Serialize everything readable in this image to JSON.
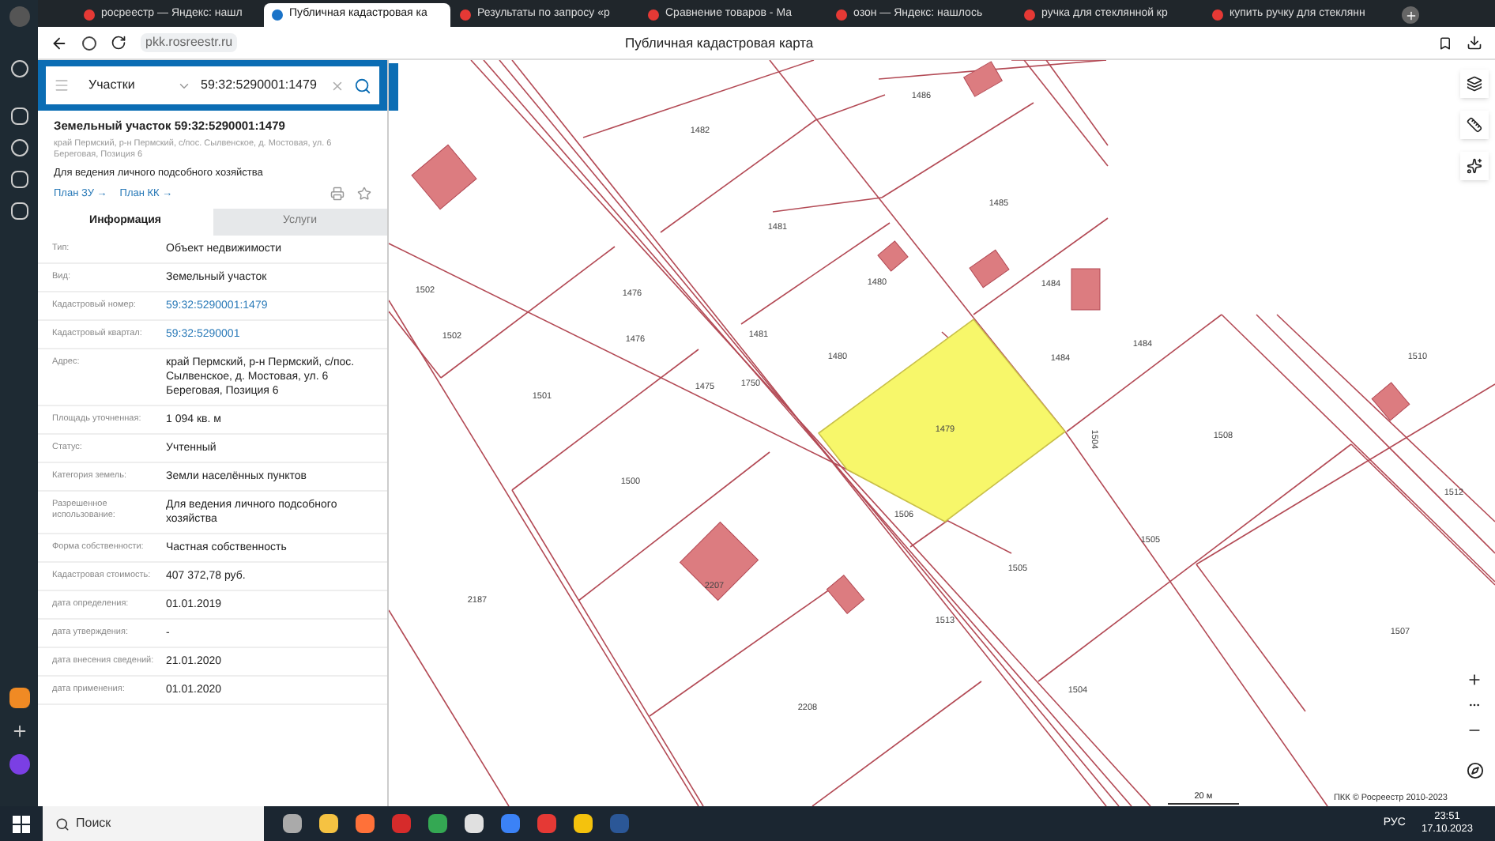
{
  "browser": {
    "tabs": [
      {
        "title": "росреестр — Яндекс: нашл",
        "selected": false
      },
      {
        "title": "Публичная кадастровая ка",
        "selected": true
      },
      {
        "title": "Результаты по запросу «р",
        "selected": false
      },
      {
        "title": "Сравнение товаров - Ма",
        "selected": false
      },
      {
        "title": "озон — Яндекс: нашлось",
        "selected": false
      },
      {
        "title": "ручка для стеклянной кр",
        "selected": false
      },
      {
        "title": "купить ручку для стеклянн",
        "selected": false
      }
    ],
    "address": "pkk.rosreestr.ru",
    "page_title": "Публичная кадастровая карта"
  },
  "search": {
    "category": "Участки",
    "value": "59:32:5290001:1479"
  },
  "object": {
    "title": "Земельный участок 59:32:5290001:1479",
    "address": "край Пермский, р-н Пермский, с/пос. Сылвенское, д. Мостовая, ул. 6 Береговая, Позиция 6",
    "purpose": "Для ведения личного подсобного хозяйства",
    "links": [
      "План ЗУ →",
      "План КК →"
    ]
  },
  "panel_tabs": [
    {
      "label": "Информация",
      "selected": true
    },
    {
      "label": "Услуги",
      "selected": false
    }
  ],
  "info": [
    {
      "label": "Тип:",
      "value": "Объект недвижимости",
      "kind": "text"
    },
    {
      "label": "Вид:",
      "value": "Земельный участок",
      "kind": "text"
    },
    {
      "label": "Кадастровый номер:",
      "value": "59:32:5290001:1479",
      "kind": "link"
    },
    {
      "label": "Кадастровый квартал:",
      "value": "59:32:5290001",
      "kind": "link"
    },
    {
      "label": "Адрес:",
      "value": "край Пермский, р-н Пермский, с/пос. Сылвенское, д. Мостовая, ул. 6 Береговая, Позиция 6",
      "kind": "text"
    },
    {
      "label": "Площадь уточненная:",
      "value": "1 094 кв. м",
      "kind": "text"
    },
    {
      "label": "Статус:",
      "value": "Учтенный",
      "kind": "text"
    },
    {
      "label": "Категория земель:",
      "value": "Земли населённых пунктов",
      "kind": "text"
    },
    {
      "label": "Разрешенное использование:",
      "value": "Для ведения личного подсобного хозяйства",
      "kind": "text"
    },
    {
      "label": "Форма собственности:",
      "value": "Частная собственность",
      "kind": "text"
    },
    {
      "label": "Кадастровая стоимость:",
      "value": "407 372,78 руб.",
      "kind": "text"
    },
    {
      "label": "дата определения:",
      "value": "01.01.2019",
      "kind": "text"
    },
    {
      "label": "дата утверждения:",
      "value": "-",
      "kind": "text"
    },
    {
      "label": "дата внесения сведений:",
      "value": "21.01.2020",
      "kind": "text"
    },
    {
      "label": "дата применения:",
      "value": "01.01.2020",
      "kind": "text"
    }
  ],
  "map": {
    "parcel_labels": [
      "1482",
      "1486",
      "1481",
      "1485",
      "1480",
      "1484",
      "1502",
      "1476",
      "1502",
      "1476",
      "1481",
      "1480",
      "1484",
      "1484",
      "1510",
      "1501",
      "1475",
      "1750",
      "1479",
      "1508",
      "1504",
      "1500",
      "1506",
      "1505",
      "1505",
      "1512",
      "2187",
      "2207",
      "1513",
      "1507",
      "1504",
      "2208"
    ],
    "scale": "20 м",
    "attribution": "ПКК © Росреестр 2010-2023"
  },
  "taskbar": {
    "search": "Поиск",
    "language": "РУС",
    "time": "23:51",
    "date": "17.10.2023"
  }
}
